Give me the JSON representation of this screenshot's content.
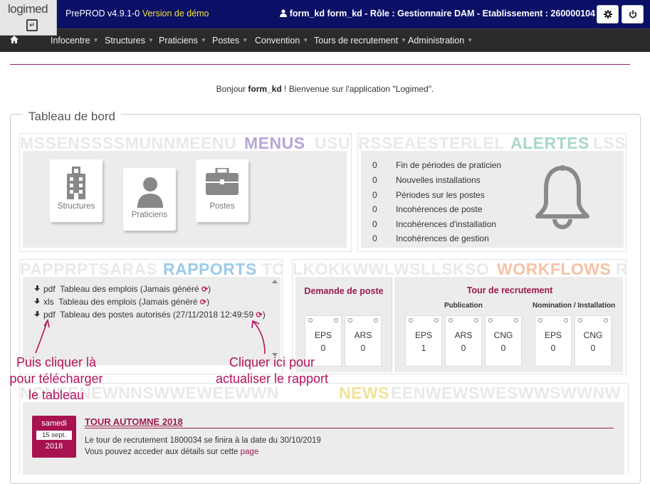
{
  "header": {
    "logo_text": "logimed",
    "version": "PrePROD v4.9.1-0",
    "demo_label": "Version de démo",
    "user_info": "form_kd form_kd - Rôle : Gestionnaire DAM - Etablissement : 260000104",
    "icons": [
      "user-icon",
      "gear-icon",
      "power-icon"
    ]
  },
  "nav": {
    "items": [
      "Infocentre",
      "Structures",
      "Praticiens",
      "Postes",
      "Convention",
      "Tours de recrutement",
      "Administration"
    ]
  },
  "welcome": {
    "prefix": "Bonjour ",
    "user": "form_kd",
    "suffix": " ! Bienvenue sur l'application \"Logimed\"."
  },
  "dashboard": {
    "title": "Tableau de bord",
    "menus": {
      "watermark": "MSSENSSSSMUNNMEENU",
      "label": "MENUS",
      "watermark_tail": "USUI",
      "tiles": [
        {
          "label": "Structures",
          "icon": "building-icon"
        },
        {
          "label": "Praticiens",
          "icon": "person-icon"
        },
        {
          "label": "Postes",
          "icon": "briefcase-icon"
        }
      ]
    },
    "alertes": {
      "watermark": "RSSEAESTERLEL",
      "label": "ALERTES",
      "watermark_tail": "LSS",
      "rows": [
        {
          "count": "0",
          "label": "Fin de périodes de praticien"
        },
        {
          "count": "0",
          "label": "Nouvelles installations"
        },
        {
          "count": "0",
          "label": "Périodes sur les postes"
        },
        {
          "count": "0",
          "label": "Incohérences de poste"
        },
        {
          "count": "0",
          "label": "Incohérences d'installation"
        },
        {
          "count": "0",
          "label": "Incohérences de gestion"
        }
      ]
    },
    "rapports": {
      "watermark": "PAPPRPTSARAS",
      "label": "RAPPORTS",
      "watermark_tail": "TO",
      "items": [
        {
          "format": "pdf",
          "text": "Tableau des emplois (Jamais généré"
        },
        {
          "format": "xls",
          "text": "Tableau des emplois (Jamais généré"
        },
        {
          "format": "pdf",
          "text": "Tableau des postes autorisés (27/11/2018 12:49:59"
        }
      ]
    },
    "workflows": {
      "watermark": "LKOKKWWLWSLLSKSO",
      "label": "WORKFLOWS",
      "watermark_tail": "R",
      "demande": {
        "title": "Demande de poste",
        "boxes": [
          {
            "code": "EPS",
            "value": "0"
          },
          {
            "code": "ARS",
            "value": "0"
          }
        ]
      },
      "tour": {
        "title": "Tour de recrutement",
        "publication_label": "Publication",
        "nomination_label": "Nomination / Installation",
        "publication": [
          {
            "code": "EPS",
            "value": "1"
          },
          {
            "code": "ARS",
            "value": "0"
          },
          {
            "code": "CNG",
            "value": "0"
          }
        ],
        "nomination": [
          {
            "code": "EPS",
            "value": "0"
          },
          {
            "code": "CNG",
            "value": "0"
          }
        ]
      }
    },
    "news": {
      "watermark": "NCNEENEWNNSWWEWEEWWN",
      "label": "NEWS",
      "watermark_tail": "EENWEWSWESWWSWWNW",
      "date_day": "samedi",
      "date_month": "15 sept.",
      "date_year": "2018",
      "title": "TOUR AUTOMNE 2018",
      "line1": "Le tour de recrutement 1800034 se finira à la date du 30/10/2019",
      "line2_prefix": "Vous pouvez acceder aux détails sur cette ",
      "line2_link": "page"
    }
  },
  "annotations": {
    "left": [
      "Puis cliquer là",
      "pour télécharger",
      "le tableau"
    ],
    "right": [
      "Cliquer ici pour",
      "actualiser le rapport"
    ]
  },
  "colors": {
    "header": "#0b0f66",
    "nav": "#2b2b2b",
    "accent": "#9c1a4e",
    "menus": "#b7a6d6",
    "alertes": "#a8d8c6",
    "rapports": "#9ccbe9",
    "workflows": "#f4c3a6",
    "news": "#f0e29a"
  }
}
